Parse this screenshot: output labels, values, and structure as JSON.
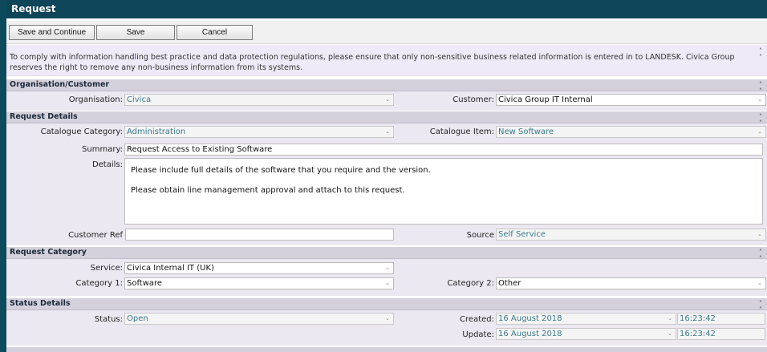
{
  "window": {
    "title": "Request"
  },
  "toolbar": {
    "save_continue": "Save and Continue",
    "save": "Save",
    "cancel": "Cancel"
  },
  "notice": {
    "text": "To comply with information handling best practice and data protection regulations, please ensure that only non-sensitive business related information is entered in to LANDESK. Civica Group reserves the right to remove any non-business information from its systems."
  },
  "organisation": {
    "heading": "Organisation/Customer",
    "org_label": "Organisation:",
    "org_value": "Civica",
    "customer_label": "Customer:",
    "customer_value": "Civica Group IT Internal"
  },
  "request_details": {
    "heading": "Request Details",
    "cat_label": "Catalogue Category:",
    "cat_value": "Administration",
    "item_label": "Catalogue Item:",
    "item_value": "New Software",
    "summary_label": "Summary:",
    "summary_value": "Request Access to  Existing Software",
    "details_label": "Details:",
    "details_line1": "Please include full details of the software that you require and the version.",
    "details_line2": "Please obtain line management approval and attach to this request.",
    "custref_label": "Customer Ref",
    "custref_value": "",
    "source_label": "Source",
    "source_value": "Self Service"
  },
  "request_category": {
    "heading": "Request Category",
    "service_label": "Service:",
    "service_value": "Civica Internal IT (UK)",
    "cat1_label": "Category 1:",
    "cat1_value": "Software",
    "cat2_label": "Category 2:",
    "cat2_value": "Other"
  },
  "status_details": {
    "heading": "Status Details",
    "status_label": "Status:",
    "status_value": "Open",
    "created_label": "Created:",
    "created_date": "16 August 2018",
    "created_time": "16:23:42",
    "update_label": "Update:",
    "update_date": "16 August 2018",
    "update_time": "16:23:42"
  },
  "icons": {
    "collapse": "double-chevron-up-icon",
    "dropdown": "chevron-down-icon"
  },
  "colors": {
    "titlebar": "#0e4558",
    "section_header": "#d5d1dc",
    "section_body": "#ece8f2",
    "readonly_text": "#3a7a8a"
  }
}
